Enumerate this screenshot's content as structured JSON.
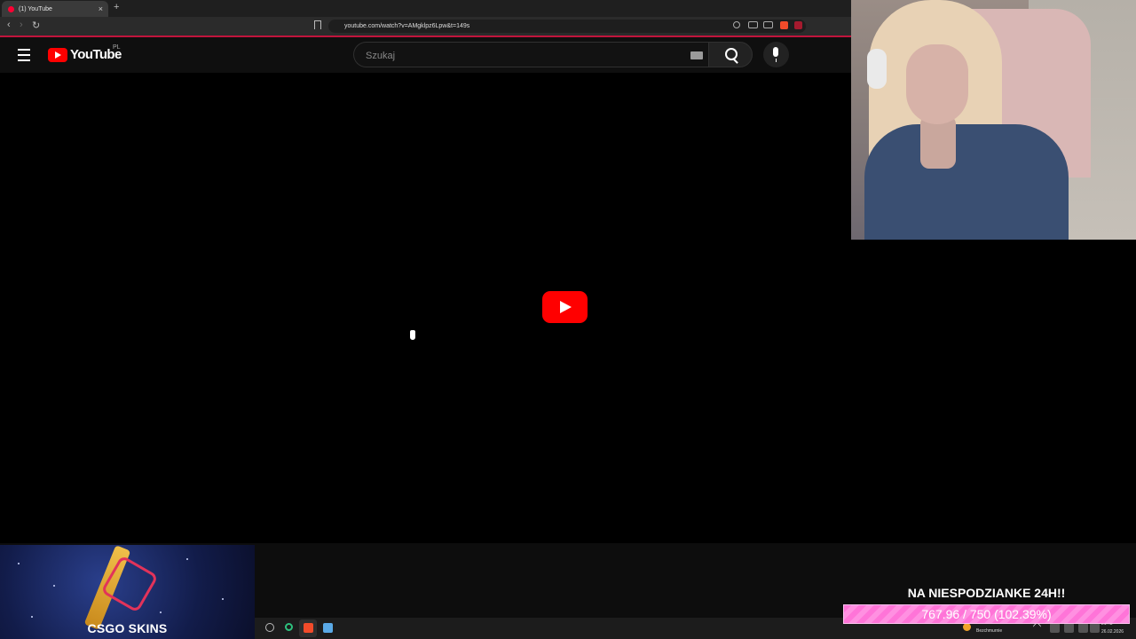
{
  "browser": {
    "tab_title": "(1) YouTube",
    "tab_close": "×",
    "new_tab": "+",
    "nav": {
      "back": "‹",
      "forward": "›",
      "reload": "↻"
    },
    "url": "youtube.com/watch?v=AMgklpz6Lpw&t=149s"
  },
  "youtube": {
    "logo_text": "YouTube",
    "region": "PL",
    "search_placeholder": "Szukaj",
    "accent": "#ff0000"
  },
  "overlay": {
    "brand": "CSGO SKINS",
    "goal": {
      "title": "NA NIESPODZIANKE 24H!!",
      "progress_text": "767.96 / 750 (102.39%)",
      "fill_fraction": 1.0,
      "bar_color": "#ff74d8"
    }
  },
  "taskbar": {
    "weather": "Bezchmurnie",
    "time": "21:43",
    "date": "26.02.2026"
  }
}
